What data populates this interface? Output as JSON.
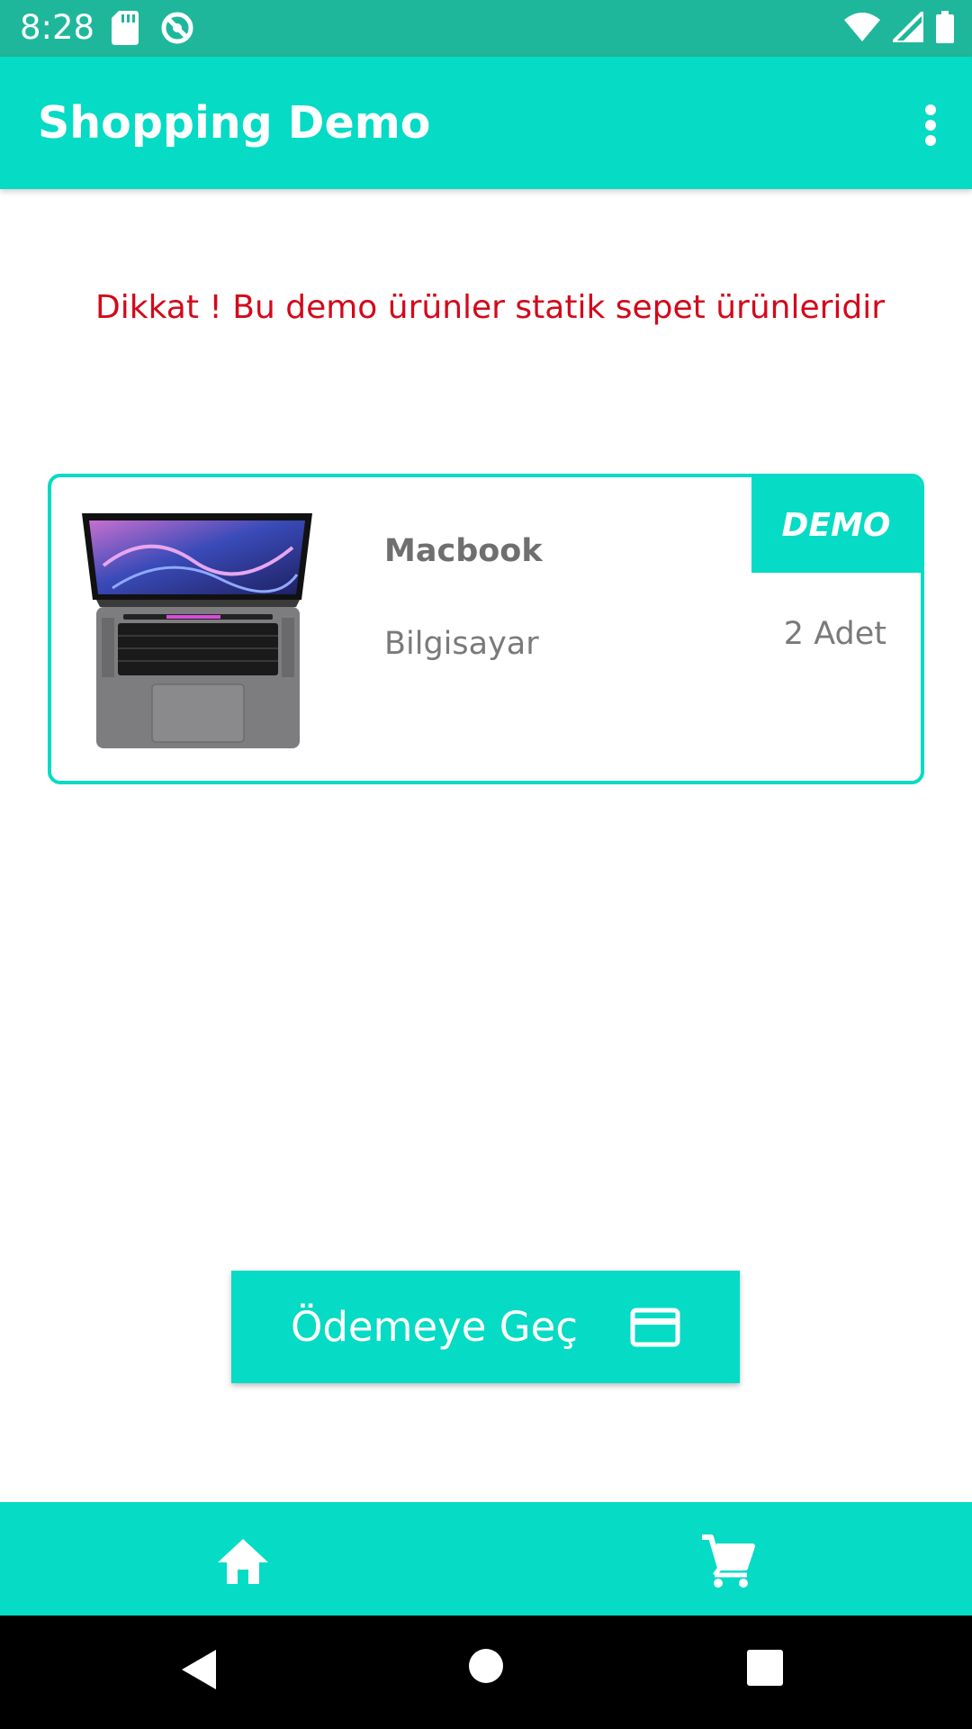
{
  "status_bar": {
    "time": "8:28",
    "icons": [
      "sd-card-icon",
      "sync-icon",
      "wifi-icon",
      "signal-icon",
      "battery-icon"
    ]
  },
  "app_bar": {
    "title": "Shopping Demo",
    "menu_icon": "more-vert-icon"
  },
  "notice": {
    "text": "Dikkat ! Bu demo ürünler statik sepet ürünleridir",
    "color": "#d3091b"
  },
  "cart_item": {
    "name": "Macbook",
    "category": "Bilgisayar",
    "badge": "DEMO",
    "quantity": "2 Adet",
    "image_icon": "laptop-image"
  },
  "checkout": {
    "label": "Ödemeye Geç",
    "icon": "credit-card-icon"
  },
  "bottom_nav": {
    "items": [
      {
        "icon": "home-icon"
      },
      {
        "icon": "shopping-cart-icon"
      }
    ]
  },
  "system_nav": [
    "back-icon",
    "home-circle-icon",
    "recents-icon"
  ],
  "colors": {
    "accent": "#05dbc5",
    "status_bar": "#1fb79b",
    "warning": "#d3091b",
    "text_gray": "#7a7a7a"
  }
}
